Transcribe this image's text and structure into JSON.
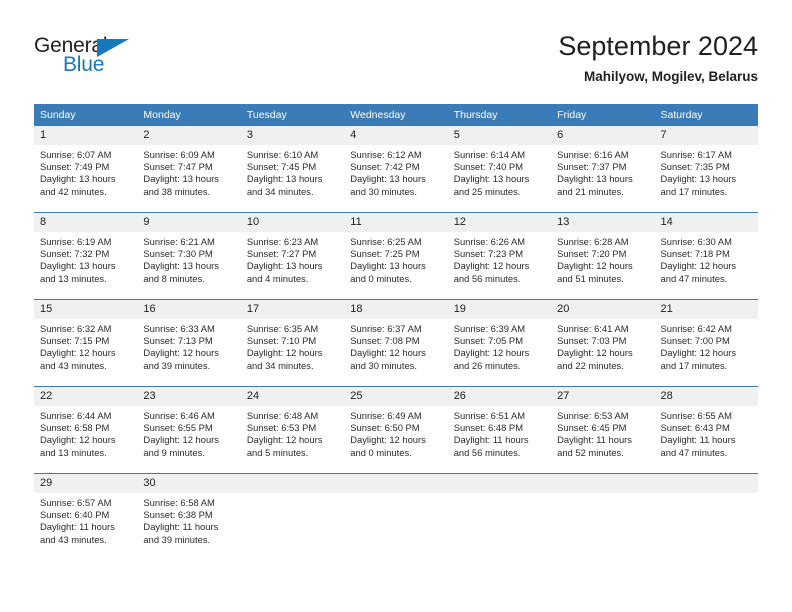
{
  "brand": {
    "name_top": "General",
    "name_bottom": "Blue",
    "accent_color": "#1878be"
  },
  "header": {
    "title": "September 2024",
    "subtitle": "Mahilyow, Mogilev, Belarus"
  },
  "colors": {
    "header_blue": "#3a7cb8",
    "date_band_gray": "#f0f0f0",
    "text": "#2b2b2b"
  },
  "weekday_headers": [
    "Sunday",
    "Monday",
    "Tuesday",
    "Wednesday",
    "Thursday",
    "Friday",
    "Saturday"
  ],
  "weeks": [
    [
      {
        "day": "1",
        "sunrise": "Sunrise: 6:07 AM",
        "sunset": "Sunset: 7:49 PM",
        "daylight1": "Daylight: 13 hours",
        "daylight2": "and 42 minutes."
      },
      {
        "day": "2",
        "sunrise": "Sunrise: 6:09 AM",
        "sunset": "Sunset: 7:47 PM",
        "daylight1": "Daylight: 13 hours",
        "daylight2": "and 38 minutes."
      },
      {
        "day": "3",
        "sunrise": "Sunrise: 6:10 AM",
        "sunset": "Sunset: 7:45 PM",
        "daylight1": "Daylight: 13 hours",
        "daylight2": "and 34 minutes."
      },
      {
        "day": "4",
        "sunrise": "Sunrise: 6:12 AM",
        "sunset": "Sunset: 7:42 PM",
        "daylight1": "Daylight: 13 hours",
        "daylight2": "and 30 minutes."
      },
      {
        "day": "5",
        "sunrise": "Sunrise: 6:14 AM",
        "sunset": "Sunset: 7:40 PM",
        "daylight1": "Daylight: 13 hours",
        "daylight2": "and 25 minutes."
      },
      {
        "day": "6",
        "sunrise": "Sunrise: 6:16 AM",
        "sunset": "Sunset: 7:37 PM",
        "daylight1": "Daylight: 13 hours",
        "daylight2": "and 21 minutes."
      },
      {
        "day": "7",
        "sunrise": "Sunrise: 6:17 AM",
        "sunset": "Sunset: 7:35 PM",
        "daylight1": "Daylight: 13 hours",
        "daylight2": "and 17 minutes."
      }
    ],
    [
      {
        "day": "8",
        "sunrise": "Sunrise: 6:19 AM",
        "sunset": "Sunset: 7:32 PM",
        "daylight1": "Daylight: 13 hours",
        "daylight2": "and 13 minutes."
      },
      {
        "day": "9",
        "sunrise": "Sunrise: 6:21 AM",
        "sunset": "Sunset: 7:30 PM",
        "daylight1": "Daylight: 13 hours",
        "daylight2": "and 8 minutes."
      },
      {
        "day": "10",
        "sunrise": "Sunrise: 6:23 AM",
        "sunset": "Sunset: 7:27 PM",
        "daylight1": "Daylight: 13 hours",
        "daylight2": "and 4 minutes."
      },
      {
        "day": "11",
        "sunrise": "Sunrise: 6:25 AM",
        "sunset": "Sunset: 7:25 PM",
        "daylight1": "Daylight: 13 hours",
        "daylight2": "and 0 minutes."
      },
      {
        "day": "12",
        "sunrise": "Sunrise: 6:26 AM",
        "sunset": "Sunset: 7:23 PM",
        "daylight1": "Daylight: 12 hours",
        "daylight2": "and 56 minutes."
      },
      {
        "day": "13",
        "sunrise": "Sunrise: 6:28 AM",
        "sunset": "Sunset: 7:20 PM",
        "daylight1": "Daylight: 12 hours",
        "daylight2": "and 51 minutes."
      },
      {
        "day": "14",
        "sunrise": "Sunrise: 6:30 AM",
        "sunset": "Sunset: 7:18 PM",
        "daylight1": "Daylight: 12 hours",
        "daylight2": "and 47 minutes."
      }
    ],
    [
      {
        "day": "15",
        "sunrise": "Sunrise: 6:32 AM",
        "sunset": "Sunset: 7:15 PM",
        "daylight1": "Daylight: 12 hours",
        "daylight2": "and 43 minutes."
      },
      {
        "day": "16",
        "sunrise": "Sunrise: 6:33 AM",
        "sunset": "Sunset: 7:13 PM",
        "daylight1": "Daylight: 12 hours",
        "daylight2": "and 39 minutes."
      },
      {
        "day": "17",
        "sunrise": "Sunrise: 6:35 AM",
        "sunset": "Sunset: 7:10 PM",
        "daylight1": "Daylight: 12 hours",
        "daylight2": "and 34 minutes."
      },
      {
        "day": "18",
        "sunrise": "Sunrise: 6:37 AM",
        "sunset": "Sunset: 7:08 PM",
        "daylight1": "Daylight: 12 hours",
        "daylight2": "and 30 minutes."
      },
      {
        "day": "19",
        "sunrise": "Sunrise: 6:39 AM",
        "sunset": "Sunset: 7:05 PM",
        "daylight1": "Daylight: 12 hours",
        "daylight2": "and 26 minutes."
      },
      {
        "day": "20",
        "sunrise": "Sunrise: 6:41 AM",
        "sunset": "Sunset: 7:03 PM",
        "daylight1": "Daylight: 12 hours",
        "daylight2": "and 22 minutes."
      },
      {
        "day": "21",
        "sunrise": "Sunrise: 6:42 AM",
        "sunset": "Sunset: 7:00 PM",
        "daylight1": "Daylight: 12 hours",
        "daylight2": "and 17 minutes."
      }
    ],
    [
      {
        "day": "22",
        "sunrise": "Sunrise: 6:44 AM",
        "sunset": "Sunset: 6:58 PM",
        "daylight1": "Daylight: 12 hours",
        "daylight2": "and 13 minutes."
      },
      {
        "day": "23",
        "sunrise": "Sunrise: 6:46 AM",
        "sunset": "Sunset: 6:55 PM",
        "daylight1": "Daylight: 12 hours",
        "daylight2": "and 9 minutes."
      },
      {
        "day": "24",
        "sunrise": "Sunrise: 6:48 AM",
        "sunset": "Sunset: 6:53 PM",
        "daylight1": "Daylight: 12 hours",
        "daylight2": "and 5 minutes."
      },
      {
        "day": "25",
        "sunrise": "Sunrise: 6:49 AM",
        "sunset": "Sunset: 6:50 PM",
        "daylight1": "Daylight: 12 hours",
        "daylight2": "and 0 minutes."
      },
      {
        "day": "26",
        "sunrise": "Sunrise: 6:51 AM",
        "sunset": "Sunset: 6:48 PM",
        "daylight1": "Daylight: 11 hours",
        "daylight2": "and 56 minutes."
      },
      {
        "day": "27",
        "sunrise": "Sunrise: 6:53 AM",
        "sunset": "Sunset: 6:45 PM",
        "daylight1": "Daylight: 11 hours",
        "daylight2": "and 52 minutes."
      },
      {
        "day": "28",
        "sunrise": "Sunrise: 6:55 AM",
        "sunset": "Sunset: 6:43 PM",
        "daylight1": "Daylight: 11 hours",
        "daylight2": "and 47 minutes."
      }
    ],
    [
      {
        "day": "29",
        "sunrise": "Sunrise: 6:57 AM",
        "sunset": "Sunset: 6:40 PM",
        "daylight1": "Daylight: 11 hours",
        "daylight2": "and 43 minutes."
      },
      {
        "day": "30",
        "sunrise": "Sunrise: 6:58 AM",
        "sunset": "Sunset: 6:38 PM",
        "daylight1": "Daylight: 11 hours",
        "daylight2": "and 39 minutes."
      },
      {
        "day": "",
        "sunrise": "",
        "sunset": "",
        "daylight1": "",
        "daylight2": ""
      },
      {
        "day": "",
        "sunrise": "",
        "sunset": "",
        "daylight1": "",
        "daylight2": ""
      },
      {
        "day": "",
        "sunrise": "",
        "sunset": "",
        "daylight1": "",
        "daylight2": ""
      },
      {
        "day": "",
        "sunrise": "",
        "sunset": "",
        "daylight1": "",
        "daylight2": ""
      },
      {
        "day": "",
        "sunrise": "",
        "sunset": "",
        "daylight1": "",
        "daylight2": ""
      }
    ]
  ]
}
